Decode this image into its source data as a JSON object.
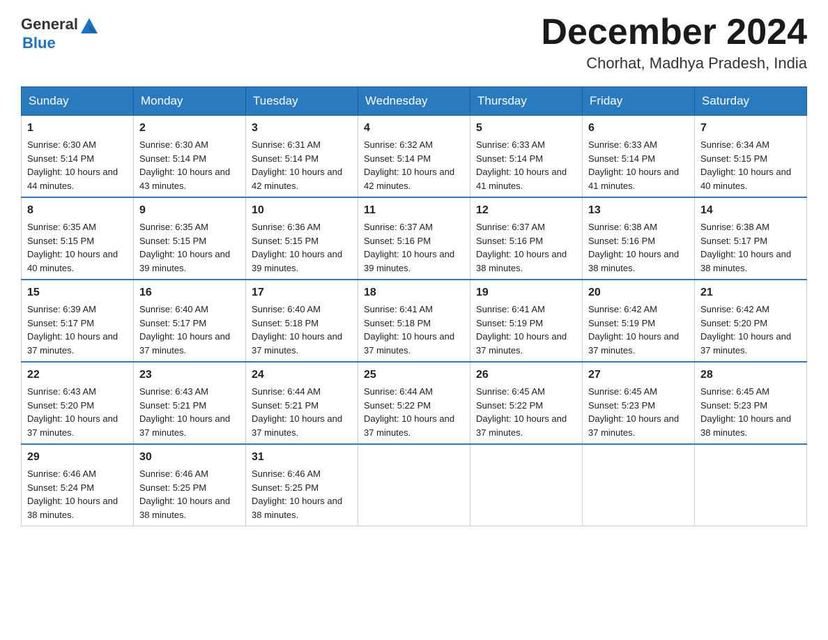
{
  "header": {
    "logo_line1": "General",
    "logo_line2": "Blue",
    "month_year": "December 2024",
    "location": "Chorhat, Madhya Pradesh, India"
  },
  "weekdays": [
    "Sunday",
    "Monday",
    "Tuesday",
    "Wednesday",
    "Thursday",
    "Friday",
    "Saturday"
  ],
  "weeks": [
    [
      {
        "day": "1",
        "sunrise": "6:30 AM",
        "sunset": "5:14 PM",
        "daylight": "10 hours and 44 minutes."
      },
      {
        "day": "2",
        "sunrise": "6:30 AM",
        "sunset": "5:14 PM",
        "daylight": "10 hours and 43 minutes."
      },
      {
        "day": "3",
        "sunrise": "6:31 AM",
        "sunset": "5:14 PM",
        "daylight": "10 hours and 42 minutes."
      },
      {
        "day": "4",
        "sunrise": "6:32 AM",
        "sunset": "5:14 PM",
        "daylight": "10 hours and 42 minutes."
      },
      {
        "day": "5",
        "sunrise": "6:33 AM",
        "sunset": "5:14 PM",
        "daylight": "10 hours and 41 minutes."
      },
      {
        "day": "6",
        "sunrise": "6:33 AM",
        "sunset": "5:14 PM",
        "daylight": "10 hours and 41 minutes."
      },
      {
        "day": "7",
        "sunrise": "6:34 AM",
        "sunset": "5:15 PM",
        "daylight": "10 hours and 40 minutes."
      }
    ],
    [
      {
        "day": "8",
        "sunrise": "6:35 AM",
        "sunset": "5:15 PM",
        "daylight": "10 hours and 40 minutes."
      },
      {
        "day": "9",
        "sunrise": "6:35 AM",
        "sunset": "5:15 PM",
        "daylight": "10 hours and 39 minutes."
      },
      {
        "day": "10",
        "sunrise": "6:36 AM",
        "sunset": "5:15 PM",
        "daylight": "10 hours and 39 minutes."
      },
      {
        "day": "11",
        "sunrise": "6:37 AM",
        "sunset": "5:16 PM",
        "daylight": "10 hours and 39 minutes."
      },
      {
        "day": "12",
        "sunrise": "6:37 AM",
        "sunset": "5:16 PM",
        "daylight": "10 hours and 38 minutes."
      },
      {
        "day": "13",
        "sunrise": "6:38 AM",
        "sunset": "5:16 PM",
        "daylight": "10 hours and 38 minutes."
      },
      {
        "day": "14",
        "sunrise": "6:38 AM",
        "sunset": "5:17 PM",
        "daylight": "10 hours and 38 minutes."
      }
    ],
    [
      {
        "day": "15",
        "sunrise": "6:39 AM",
        "sunset": "5:17 PM",
        "daylight": "10 hours and 37 minutes."
      },
      {
        "day": "16",
        "sunrise": "6:40 AM",
        "sunset": "5:17 PM",
        "daylight": "10 hours and 37 minutes."
      },
      {
        "day": "17",
        "sunrise": "6:40 AM",
        "sunset": "5:18 PM",
        "daylight": "10 hours and 37 minutes."
      },
      {
        "day": "18",
        "sunrise": "6:41 AM",
        "sunset": "5:18 PM",
        "daylight": "10 hours and 37 minutes."
      },
      {
        "day": "19",
        "sunrise": "6:41 AM",
        "sunset": "5:19 PM",
        "daylight": "10 hours and 37 minutes."
      },
      {
        "day": "20",
        "sunrise": "6:42 AM",
        "sunset": "5:19 PM",
        "daylight": "10 hours and 37 minutes."
      },
      {
        "day": "21",
        "sunrise": "6:42 AM",
        "sunset": "5:20 PM",
        "daylight": "10 hours and 37 minutes."
      }
    ],
    [
      {
        "day": "22",
        "sunrise": "6:43 AM",
        "sunset": "5:20 PM",
        "daylight": "10 hours and 37 minutes."
      },
      {
        "day": "23",
        "sunrise": "6:43 AM",
        "sunset": "5:21 PM",
        "daylight": "10 hours and 37 minutes."
      },
      {
        "day": "24",
        "sunrise": "6:44 AM",
        "sunset": "5:21 PM",
        "daylight": "10 hours and 37 minutes."
      },
      {
        "day": "25",
        "sunrise": "6:44 AM",
        "sunset": "5:22 PM",
        "daylight": "10 hours and 37 minutes."
      },
      {
        "day": "26",
        "sunrise": "6:45 AM",
        "sunset": "5:22 PM",
        "daylight": "10 hours and 37 minutes."
      },
      {
        "day": "27",
        "sunrise": "6:45 AM",
        "sunset": "5:23 PM",
        "daylight": "10 hours and 37 minutes."
      },
      {
        "day": "28",
        "sunrise": "6:45 AM",
        "sunset": "5:23 PM",
        "daylight": "10 hours and 38 minutes."
      }
    ],
    [
      {
        "day": "29",
        "sunrise": "6:46 AM",
        "sunset": "5:24 PM",
        "daylight": "10 hours and 38 minutes."
      },
      {
        "day": "30",
        "sunrise": "6:46 AM",
        "sunset": "5:25 PM",
        "daylight": "10 hours and 38 minutes."
      },
      {
        "day": "31",
        "sunrise": "6:46 AM",
        "sunset": "5:25 PM",
        "daylight": "10 hours and 38 minutes."
      },
      null,
      null,
      null,
      null
    ]
  ]
}
